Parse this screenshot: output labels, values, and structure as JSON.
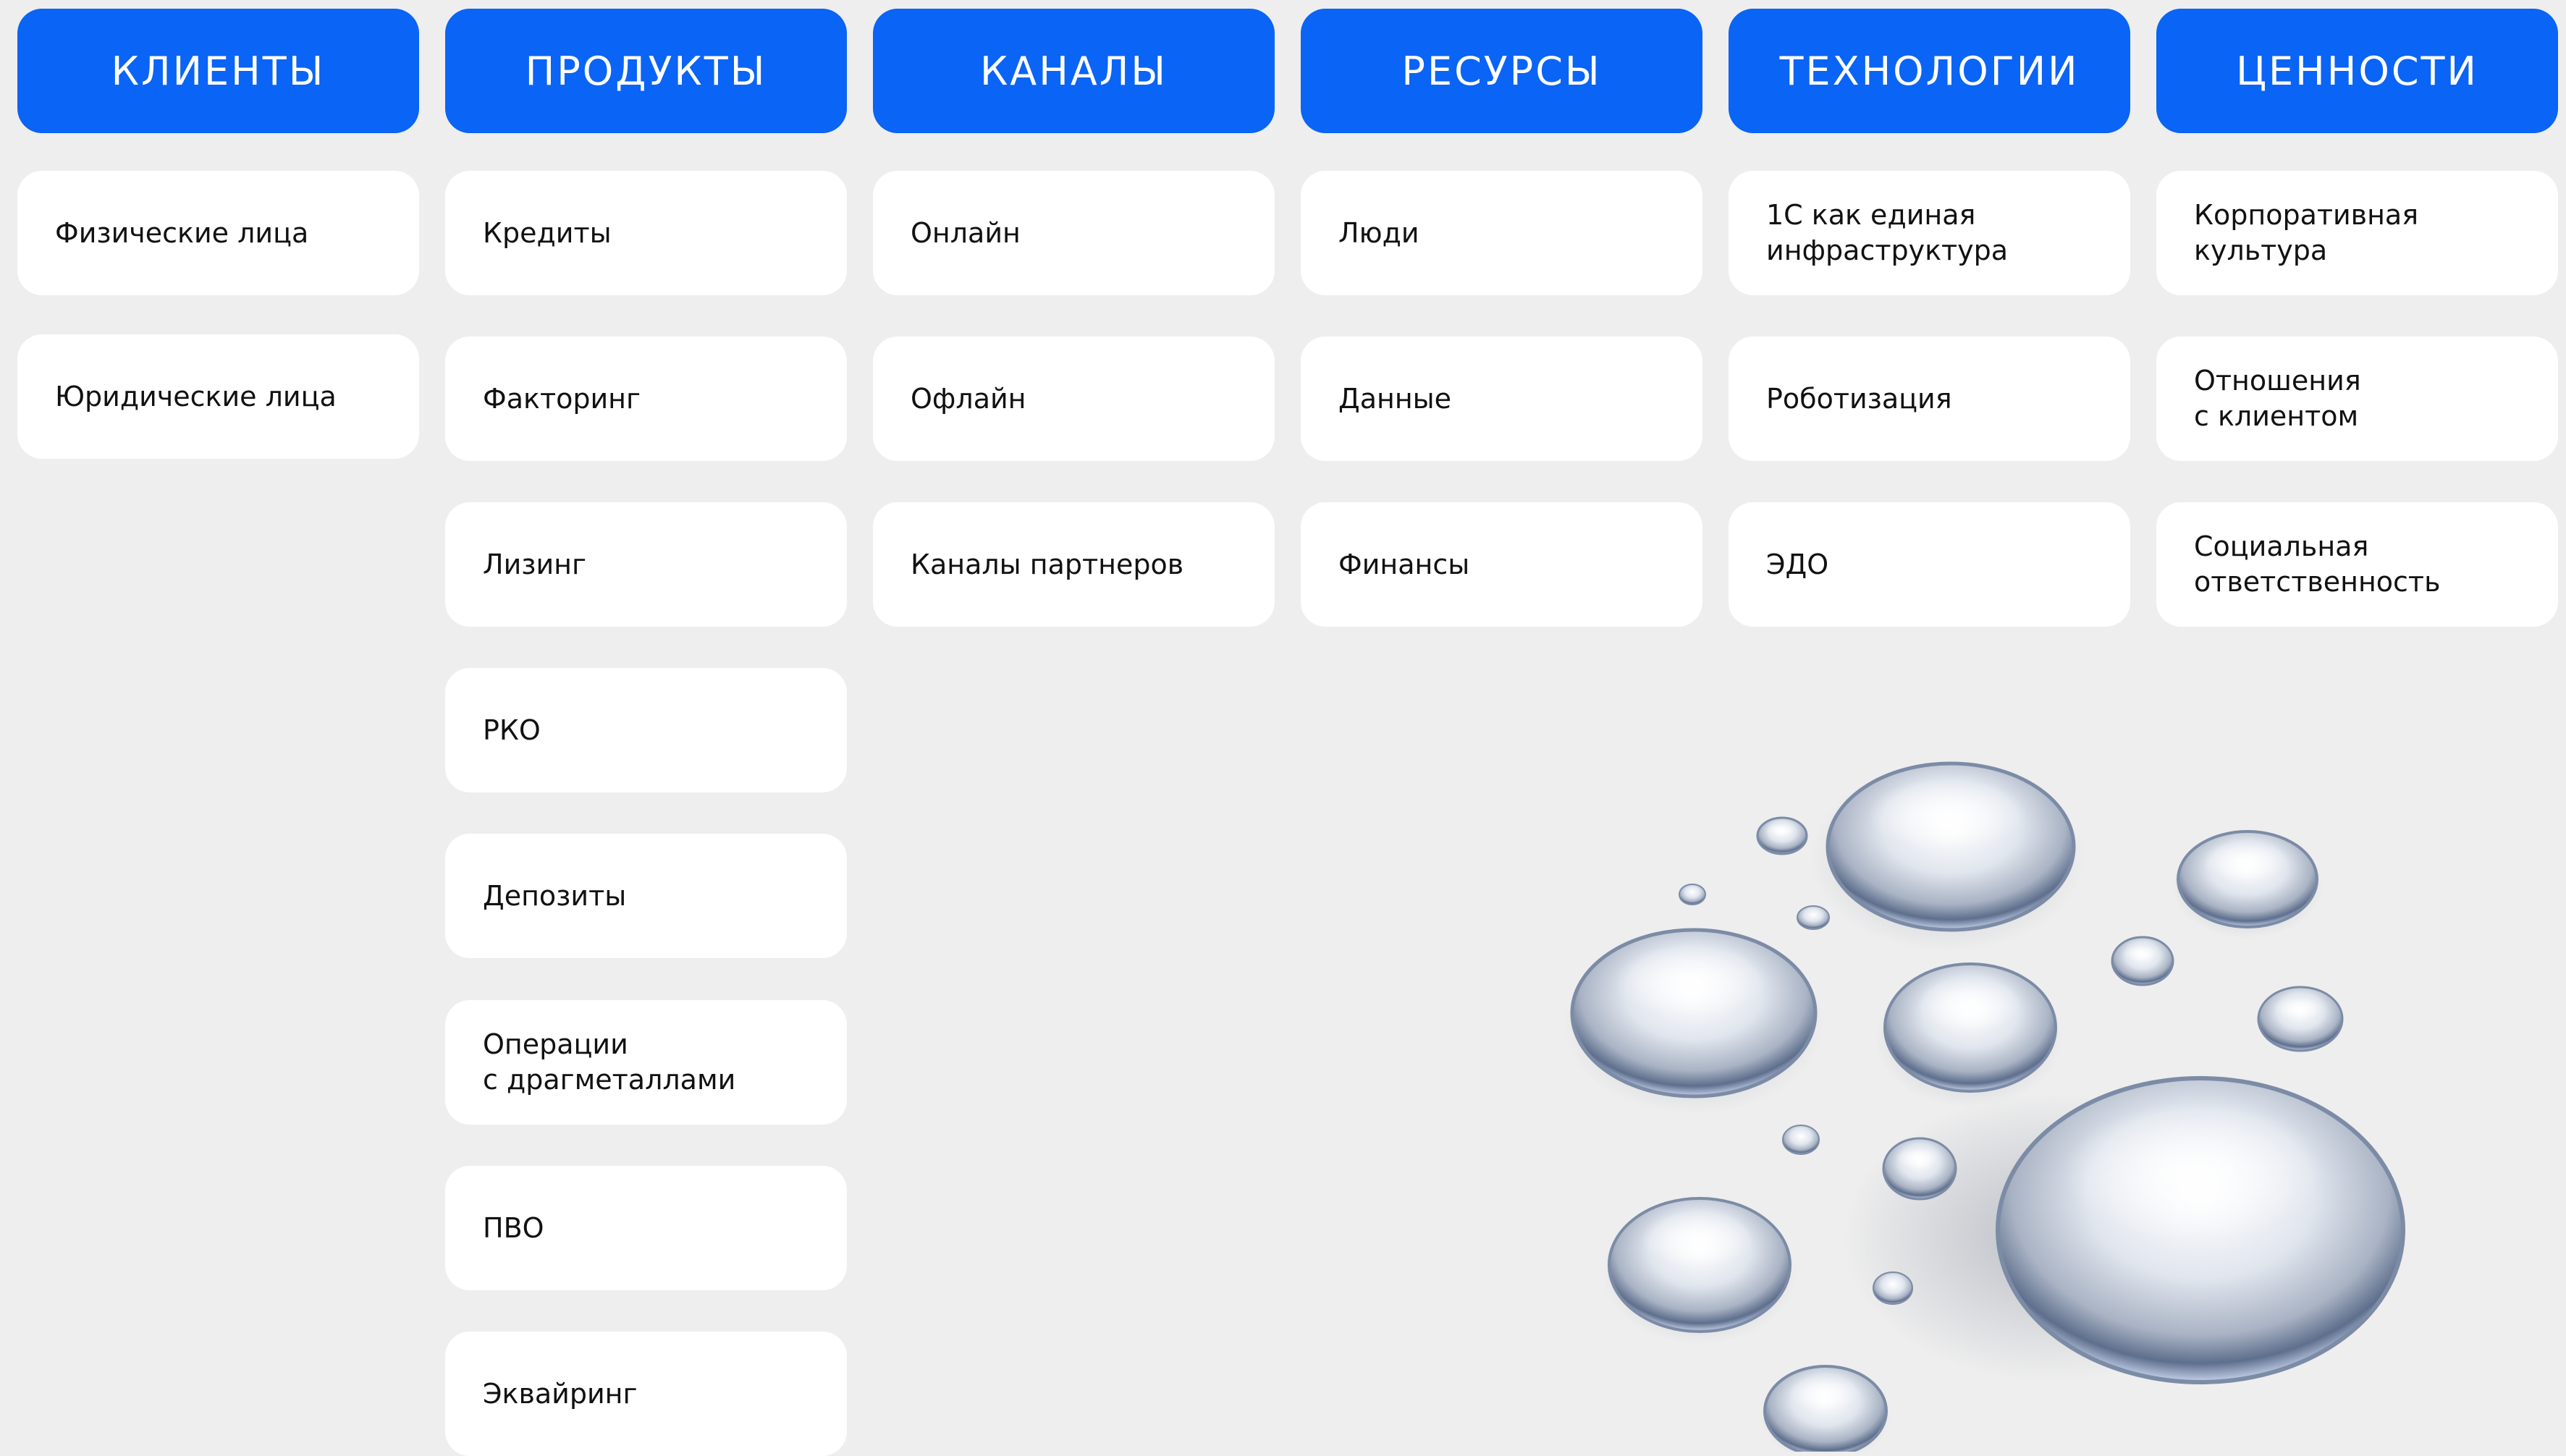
{
  "columns": [
    {
      "header": "КЛИЕНТЫ",
      "items": [
        "Физические лица",
        "Юридические лица"
      ]
    },
    {
      "header": "ПРОДУКТЫ",
      "items": [
        "Кредиты",
        "Факторинг",
        "Лизинг",
        "РКО",
        "Депозиты",
        "Операции\nс драгметаллами",
        "ПВО",
        "Эквайринг"
      ]
    },
    {
      "header": "КАНАЛЫ",
      "items": [
        "Онлайн",
        "Офлайн",
        "Каналы партнеров"
      ]
    },
    {
      "header": "РЕСУРСЫ",
      "items": [
        "Люди",
        "Данные",
        "Финансы"
      ]
    },
    {
      "header": "ТЕХНОЛОГИИ",
      "items": [
        "1С как единая\nинфраструктура",
        "Роботизация",
        "ЭДО"
      ]
    },
    {
      "header": "ЦЕННОСТИ",
      "items": [
        "Корпоративная\nкультура",
        "Отношения\nс клиентом",
        "Социальная\nответственность"
      ]
    }
  ],
  "colors": {
    "background": "#eeeeee",
    "header": "#0a64f5",
    "header_text": "#ffffff",
    "card": "#ffffff",
    "card_text": "#111111"
  },
  "decoration": "mercury-droplets-icon"
}
